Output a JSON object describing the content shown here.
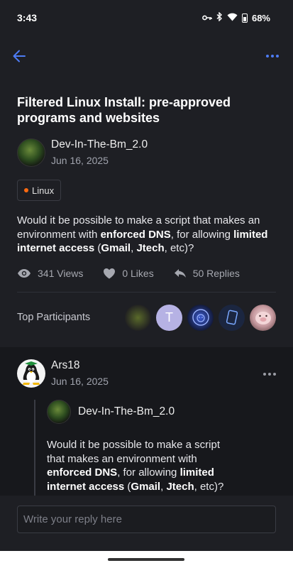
{
  "status_bar": {
    "time": "3:43",
    "battery": "68%"
  },
  "topic": {
    "title": "Filtered Linux Install: pre-approved programs and websites",
    "author": "Dev-In-The-Bm_2.0",
    "date": "Jun 16, 2025",
    "tag": "Linux",
    "body_before_1": "Would it be possible to make a script that makes an environment with ",
    "body_bold_1": "enforced DNS",
    "body_middle_1": ", for allowing ",
    "body_bold_2": "limited internet access",
    "body_middle_2": " (",
    "body_bold_3": "Gmail",
    "body_middle_3": ", ",
    "body_bold_4": "Jtech",
    "body_after": ", etc)?"
  },
  "stats": {
    "views": "341 Views",
    "likes": "0 Likes",
    "replies": "50 Replies"
  },
  "participants": {
    "label": "Top Participants",
    "letter_avatar": "T"
  },
  "reply": {
    "author": "Ars18",
    "date": "Jun 16, 2025",
    "quote_author": "Dev-In-The-Bm_2.0"
  },
  "composer": {
    "placeholder": "Write your reply here"
  },
  "colors": {
    "accent": "#4d7cf5",
    "tag_dot": "#ff6a10",
    "background": "#1e1f24",
    "reply_background": "#17181c"
  }
}
